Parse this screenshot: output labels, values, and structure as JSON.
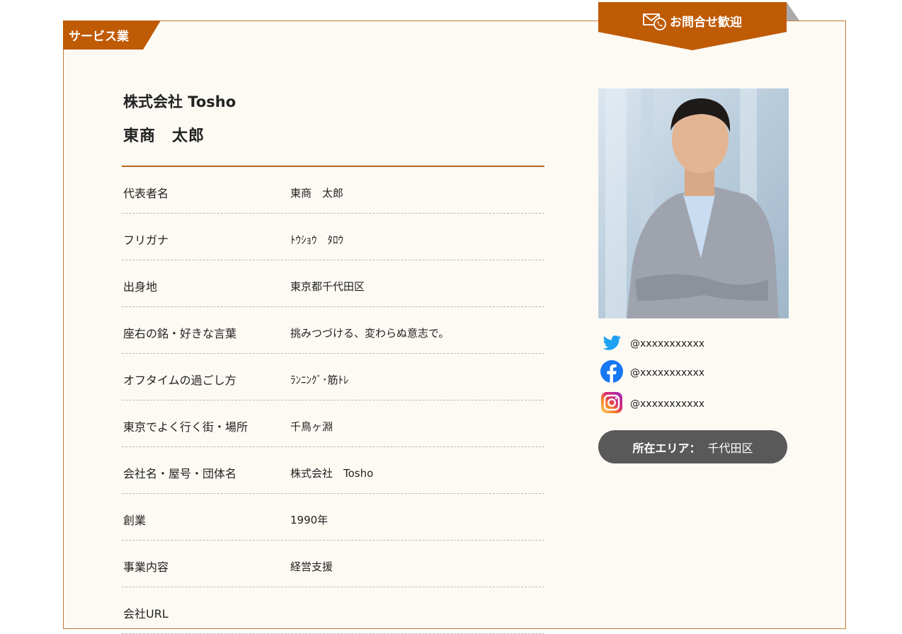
{
  "category": "サービス業",
  "ribbon": {
    "label": "お問合せ歓迎",
    "icon": "mail-phone-icon"
  },
  "profile": {
    "company": "株式会社 Tosho",
    "name": "東商　太郎"
  },
  "details": [
    {
      "label": "代表者名",
      "value": "東商　太郎"
    },
    {
      "label": "フリガナ",
      "value": "ﾄｳｼｮｳ　ﾀﾛｳ"
    },
    {
      "label": "出身地",
      "value": "東京都千代田区"
    },
    {
      "label": "座右の銘・好きな言葉",
      "value": "挑みつづける、変わらぬ意志で。"
    },
    {
      "label": "オフタイムの過ごし方",
      "value": "ﾗﾝﾆﾝｸﾞ･筋ﾄﾚ"
    },
    {
      "label": "東京でよく行く街・場所",
      "value": "千鳥ヶ淵"
    },
    {
      "label": "会社名・屋号・団体名",
      "value": "株式会社　Tosho"
    },
    {
      "label": "創業",
      "value": "1990年"
    },
    {
      "label": "事業内容",
      "value": "経営支援"
    },
    {
      "label": "会社URL",
      "value": ""
    }
  ],
  "sns": [
    {
      "icon": "twitter-icon",
      "handle": "@xxxxxxxxxxx",
      "color": "#1da1f2"
    },
    {
      "icon": "facebook-icon",
      "handle": "@xxxxxxxxxxx",
      "color": "#1877f2"
    },
    {
      "icon": "instagram-icon",
      "handle": "@xxxxxxxxxxx",
      "color": "#d62976"
    }
  ],
  "area": {
    "label": "所在エリア：",
    "value": "千代田区"
  },
  "colors": {
    "accent": "#bf5a05",
    "pill": "#595959",
    "card_bg": "#fdfaf4"
  }
}
